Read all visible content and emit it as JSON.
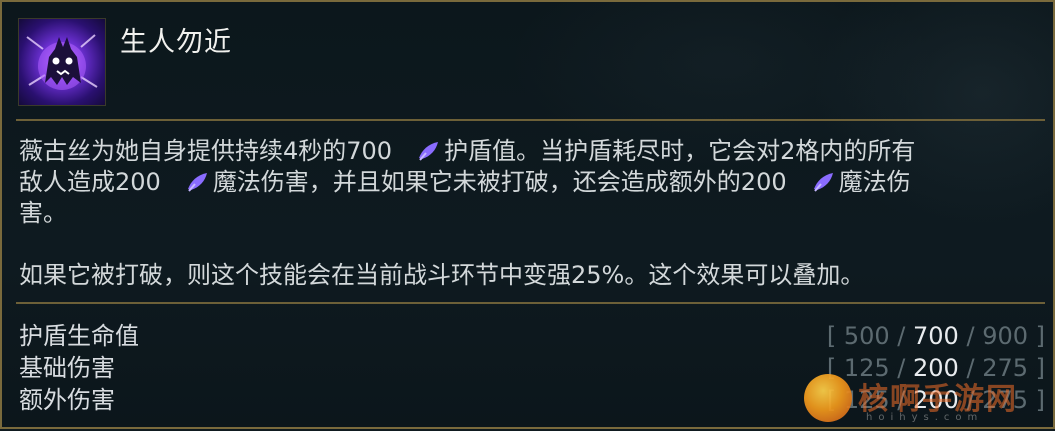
{
  "ability": {
    "name": "生人勿近",
    "icon": "shadow-creature-icon"
  },
  "description": {
    "line1_a": "薇古丝为她自身提供持续4秒的700",
    "line1_b": "护盾值。当护盾耗尽时，它会对2格内的所有",
    "line2_a": "敌人造成200",
    "line2_b": "魔法伤害，并且如果它未被打破，还会造成额外的200",
    "line2_c": "魔法伤",
    "line3": "害。",
    "para2": "如果它被打破，则这个技能会在当前战斗环节中变强25%。这个效果可以叠加。"
  },
  "stats": [
    {
      "label": "护盾生命值",
      "values": [
        "500",
        "700",
        "900"
      ],
      "active_index": 1
    },
    {
      "label": "基础伤害",
      "values": [
        "125",
        "200",
        "275"
      ],
      "active_index": 1
    },
    {
      "label": "额外伤害",
      "values": [
        "125",
        "200",
        "275"
      ],
      "active_index": 1
    }
  ],
  "watermark": {
    "text": "核啊手游网",
    "sub": "hoihys.com"
  },
  "colors": {
    "border": "#7a6a3c",
    "damage_icon": "#8a6cff",
    "active_value": "#e9ecef",
    "dim_value": "#5c6a70"
  }
}
